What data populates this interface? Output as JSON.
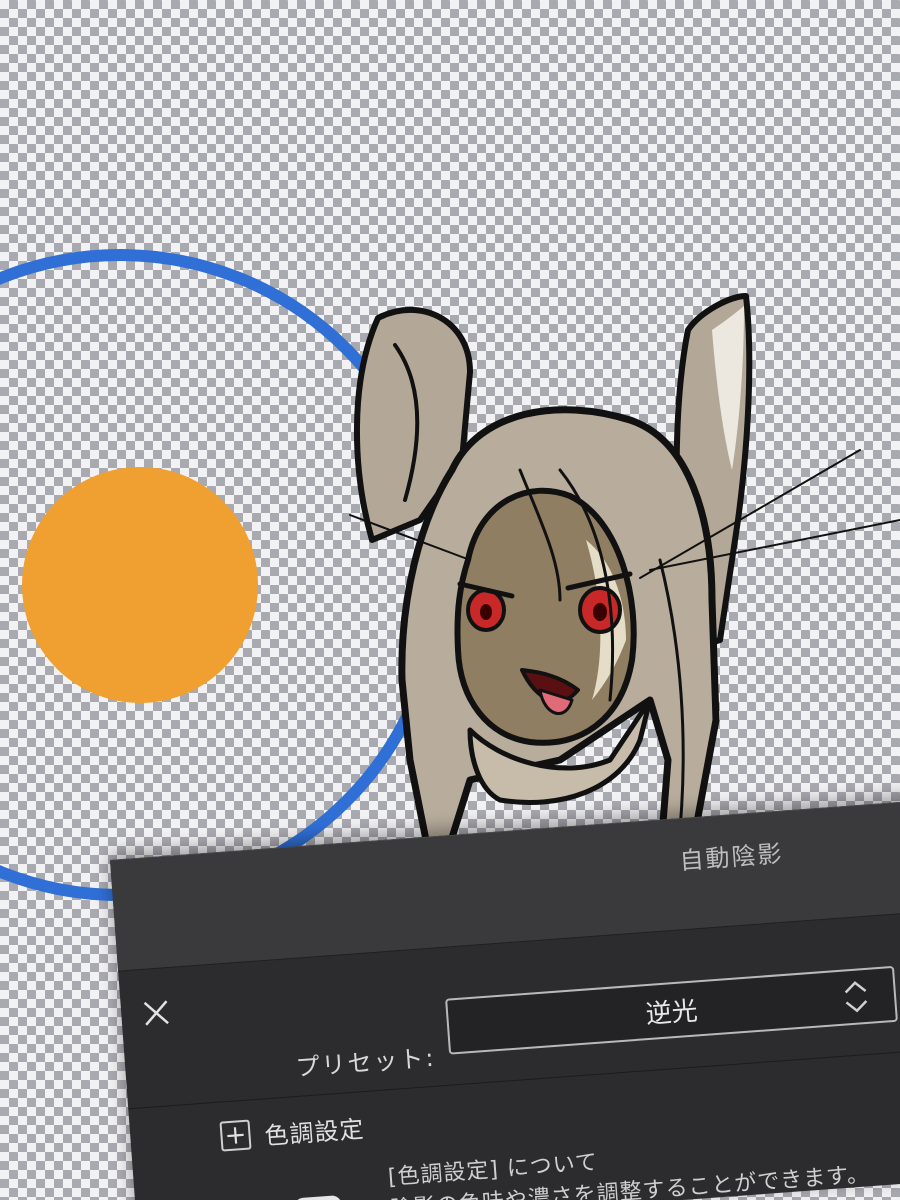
{
  "dialog": {
    "title": "自動陰影",
    "close_icon": "close-icon",
    "preset": {
      "label": "プリセット:",
      "value": "逆光"
    },
    "tone_section": {
      "toggle_symbol": "+",
      "label": "色調設定"
    },
    "info": {
      "heading": "[色調設定] について",
      "body": "陰影の色味や濃さを調整することができます。"
    }
  },
  "colors": {
    "light_source_ring": "#2f6fd6",
    "light_source_dot": "#f0a030",
    "panel_background": "#2c2c2e",
    "character_fill": "#b0a595"
  }
}
